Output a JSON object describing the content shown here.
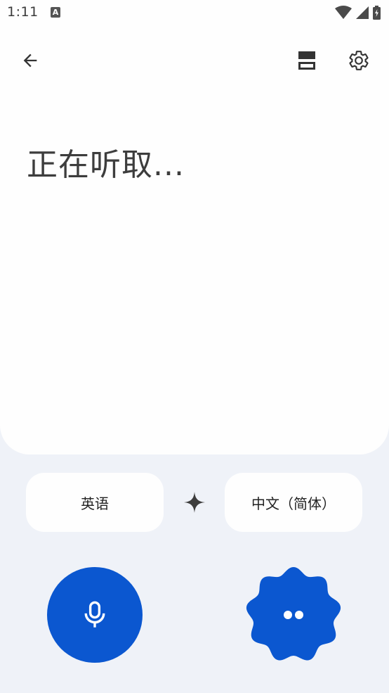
{
  "status_bar": {
    "time": "1:11",
    "notification_glyph": "A",
    "icons": [
      "wifi-icon",
      "signal-icon",
      "battery-charging-icon"
    ]
  },
  "toolbar": {
    "back_icon": "arrow-back-icon",
    "layout_icon": "split-layout-icon",
    "settings_icon": "gear-icon"
  },
  "transcript": {
    "status_text": "正在听取..."
  },
  "languages": {
    "source": "英语",
    "target": "中文（简体）",
    "swap_icon": "sparkle-icon"
  },
  "actions": {
    "mic_icon": "microphone-icon",
    "conversation_icon": "two-dots-icon"
  },
  "colors": {
    "accent": "#0b57d0",
    "background": "#eff2f8",
    "surface": "#fefefe"
  }
}
